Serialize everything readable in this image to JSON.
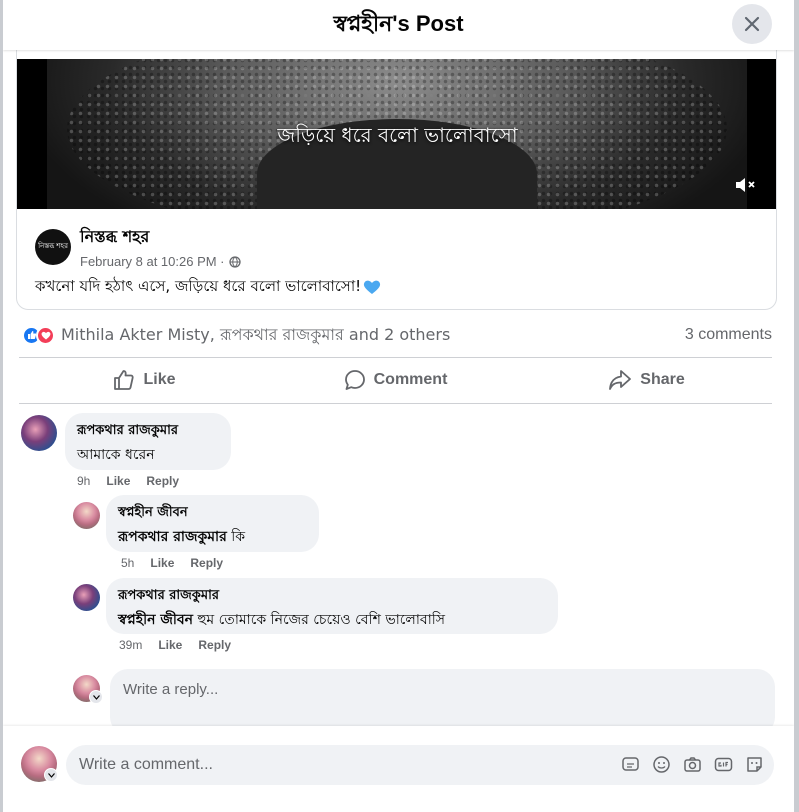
{
  "dialog": {
    "title": "স্বপ্নহীন's Post"
  },
  "shared_post": {
    "video_caption": "জড়িয়ে ধরে বলো ভালোবাসো",
    "page_name": "নিস্তব্ধ শহর",
    "page_avatar_text": "নিস্তব্ধ শহর",
    "timestamp": "February 8 at 10:26 PM ·",
    "text": "কখনো যদি হঠাৎ এসে, জড়িয়ে ধরে বলো ভালোবাসো!"
  },
  "reactions": {
    "names": "Mithila Akter Misty, রূপকথার রাজকুমার and 2 others",
    "comment_count": "3 comments"
  },
  "actions": {
    "like": "Like",
    "comment": "Comment",
    "share": "Share"
  },
  "comments": [
    {
      "author": "রূপকথার রাজকুমার",
      "text": "আমাকে ধরেন",
      "time": "9h",
      "like": "Like",
      "reply": "Reply"
    },
    {
      "author": "স্বপ্নহীন জীবন",
      "tag": "রূপকথার রাজকুমার",
      "text": " কি",
      "time": "5h",
      "like": "Like",
      "reply": "Reply"
    },
    {
      "author": "রূপকথার রাজকুমার",
      "tag": "স্বপ্নহীন জীবন",
      "text": " হুম তোমাকে নিজের চেয়েও বেশি ভালোবাসি",
      "time": "39m",
      "like": "Like",
      "reply": "Reply"
    }
  ],
  "reply_box": {
    "placeholder": "Write a reply..."
  },
  "comment_box": {
    "placeholder": "Write a comment..."
  },
  "icons": [
    "close-icon",
    "mute-icon",
    "globe-icon",
    "heart-icon",
    "like-reaction-icon",
    "love-reaction-icon",
    "thumbs-up-icon",
    "comment-icon",
    "share-icon",
    "sticker-icon",
    "emoji-icon",
    "camera-icon",
    "gif-icon",
    "avatar-sticker-icon"
  ],
  "colors": {
    "accent": "#1877f2",
    "love": "#f33e58",
    "secondary_text": "#65676b",
    "bubble": "#f0f2f5"
  }
}
